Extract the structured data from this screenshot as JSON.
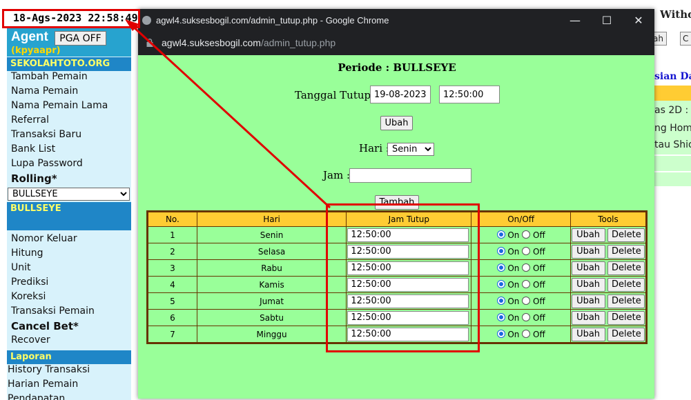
{
  "annotation_date": "18-Ags-2023 22:58:49",
  "sidebar": {
    "agent_title": "Agent",
    "pga_button": "PGA OFF",
    "agent_sub": "(kpyaapr)",
    "section1": "SEKOLAHTOTO.ORG",
    "menu1": [
      "Tambah Pemain",
      "Nama Pemain",
      "Nama Pemain Lama",
      "Referral",
      "Transaksi Baru",
      "Bank List",
      "Lupa Password"
    ],
    "rolling_label": "Rolling*",
    "rolling_select": "BULLSEYE",
    "bulls_head": "BULLSEYE",
    "menu2": [
      "Nomor Keluar",
      "Hitung",
      "Unit",
      "Prediksi",
      "Koreksi",
      "Transaksi Pemain"
    ],
    "cancel_bet": "Cancel Bet*",
    "recover": "Recover",
    "laporan": "Laporan",
    "menu3": [
      "History Transaksi",
      "Harian Pemain",
      "Pendapatan"
    ]
  },
  "background": {
    "top_right": "Withd",
    "btn1": "ah",
    "btn2": "C",
    "link": "sian Da",
    "row1": "as 2D :",
    "row2": "ng Hom",
    "row3": "tau Shio"
  },
  "window": {
    "title": "agwl4.suksesbogil.com/admin_tutup.php - Google Chrome",
    "minimize": "—",
    "maximize": "☐",
    "close": "✕",
    "url_domain": "agwl4.suksesbogil.com",
    "url_path": "/admin_tutup.php"
  },
  "form": {
    "periode": "Periode  : BULLSEYE",
    "tanggal_label": "Tanggal Tutup :",
    "tanggal_value": "19-08-2023",
    "jam_value": "12:50:00",
    "ubah": "Ubah",
    "hari_label": "Hari :",
    "hari_value": "Senin",
    "jam_label": "Jam :",
    "jam_input": "",
    "tambah": "Tambah"
  },
  "table": {
    "headers": [
      "No.",
      "Hari",
      "Jam Tutup",
      "On/Off",
      "Tools"
    ],
    "on_label": "On",
    "off_label": "Off",
    "ubah": "Ubah",
    "delete": "Delete",
    "rows": [
      {
        "no": "1",
        "hari": "Senin",
        "jam": "12:50:00"
      },
      {
        "no": "2",
        "hari": "Selasa",
        "jam": "12:50:00"
      },
      {
        "no": "3",
        "hari": "Rabu",
        "jam": "12:50:00"
      },
      {
        "no": "4",
        "hari": "Kamis",
        "jam": "12:50:00"
      },
      {
        "no": "5",
        "hari": "Jumat",
        "jam": "12:50:00"
      },
      {
        "no": "6",
        "hari": "Sabtu",
        "jam": "12:50:00"
      },
      {
        "no": "7",
        "hari": "Minggu",
        "jam": "12:50:00"
      }
    ]
  },
  "colors": {
    "content_bg": "#99ff99",
    "header_bg": "#ffcc33",
    "table_border": "#663300",
    "annotation_red": "#e00000",
    "sidebar_bg": "#d8f2fb",
    "sidebar_head": "#1f86c7"
  }
}
